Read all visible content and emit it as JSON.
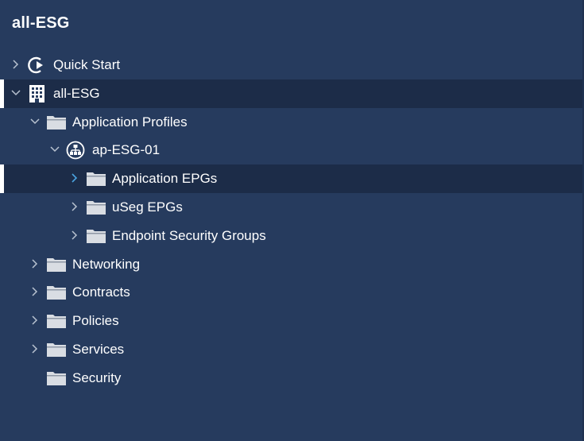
{
  "panel": {
    "title": "all-ESG"
  },
  "tree": {
    "quick_start": {
      "label": "Quick Start",
      "icon": "quick-start-icon"
    },
    "tenant": {
      "label": "all-ESG",
      "icon": "building-icon"
    },
    "application_profiles": {
      "label": "Application Profiles",
      "icon": "folder-icon"
    },
    "ap_esg": {
      "label": "ap-ESG-01",
      "icon": "application-profile-icon"
    },
    "application_epgs": {
      "label": "Application EPGs",
      "icon": "folder-icon"
    },
    "useg_epgs": {
      "label": "uSeg EPGs",
      "icon": "folder-icon"
    },
    "endpoint_security_groups": {
      "label": "Endpoint Security Groups",
      "icon": "folder-icon"
    },
    "networking": {
      "label": "Networking",
      "icon": "folder-icon"
    },
    "contracts": {
      "label": "Contracts",
      "icon": "folder-icon"
    },
    "policies": {
      "label": "Policies",
      "icon": "folder-icon"
    },
    "services": {
      "label": "Services",
      "icon": "folder-icon"
    },
    "security": {
      "label": "Security",
      "icon": "folder-icon"
    }
  },
  "colors": {
    "background": "#263b5e",
    "selected_row": "#1c2c48",
    "active_chevron": "#4aa3df",
    "folder_icon": "#d9dde3"
  }
}
